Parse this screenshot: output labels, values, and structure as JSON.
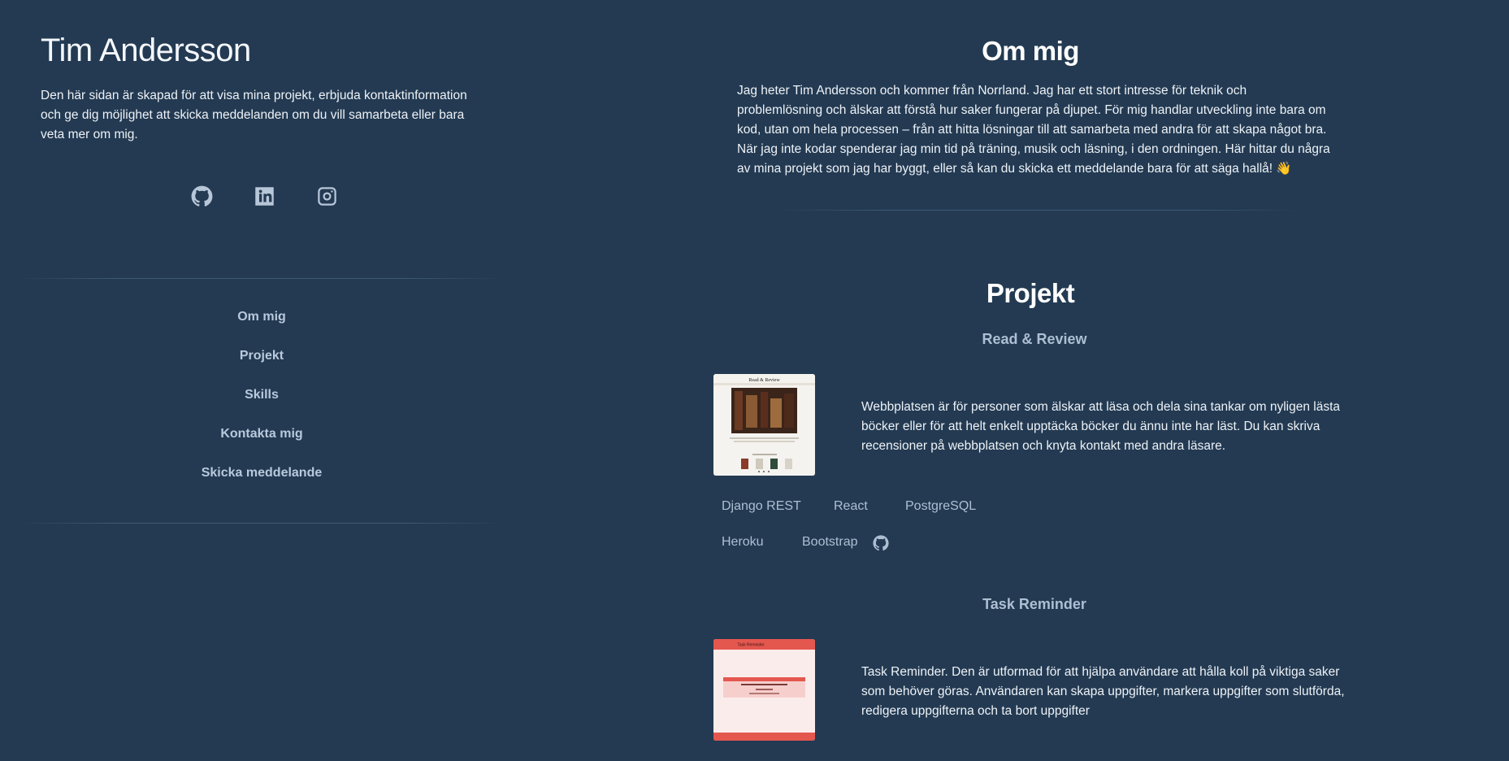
{
  "sidebar": {
    "name": "Tim Andersson",
    "intro": "Den här sidan är skapad för att visa mina projekt, erbjuda kontaktinformation och ge dig möjlighet att skicka meddelanden om du vill samarbeta eller bara veta mer om mig.",
    "socials": [
      {
        "icon": "github-icon"
      },
      {
        "icon": "linkedin-icon"
      },
      {
        "icon": "instagram-icon"
      }
    ],
    "nav": [
      {
        "label": "Om mig"
      },
      {
        "label": "Projekt"
      },
      {
        "label": "Skills"
      },
      {
        "label": "Kontakta mig"
      },
      {
        "label": "Skicka meddelande"
      }
    ]
  },
  "about": {
    "heading": "Om mig",
    "text": "Jag heter Tim Andersson och kommer från Norrland. Jag har ett stort intresse för teknik och problemlösning och älskar att förstå hur saker fungerar på djupet. För mig handlar utveckling inte bara om kod, utan om hela processen – från att hitta lösningar till att samarbeta med andra för att skapa något bra. När jag inte kodar spenderar jag min tid på träning, musik och läsning, i den ordningen. Här hittar du några av mina projekt som jag har byggt, eller så kan du skicka ett meddelande bara för att säga hallå! 👋"
  },
  "projects": {
    "heading": "Projekt",
    "items": [
      {
        "title": "Read & Review",
        "description": "Webbplatsen är för personer som älskar att läsa och dela sina tankar om nyligen lästa böcker eller för att helt enkelt upptäcka böcker du ännu inte har läst. Du kan skriva recensioner på webbplatsen och knyta kontakt med andra läsare.",
        "tech": [
          "Django REST",
          "React",
          "PostgreSQL",
          "Heroku",
          "Bootstrap"
        ],
        "thumb_text": "Read & Review"
      },
      {
        "title": "Task Reminder",
        "description": "Task Reminder. Den är utformad för att hjälpa användare att hålla koll på viktiga saker som behöver göras. Användaren kan skapa uppgifter, markera uppgifter som slutförda, redigera uppgifterna och ta bort uppgifter",
        "thumb_text": "Task Reminder"
      }
    ]
  },
  "colors": {
    "background": "#233a52",
    "accent_text": "#aebfd3",
    "task_thumb": "#e4574f"
  }
}
